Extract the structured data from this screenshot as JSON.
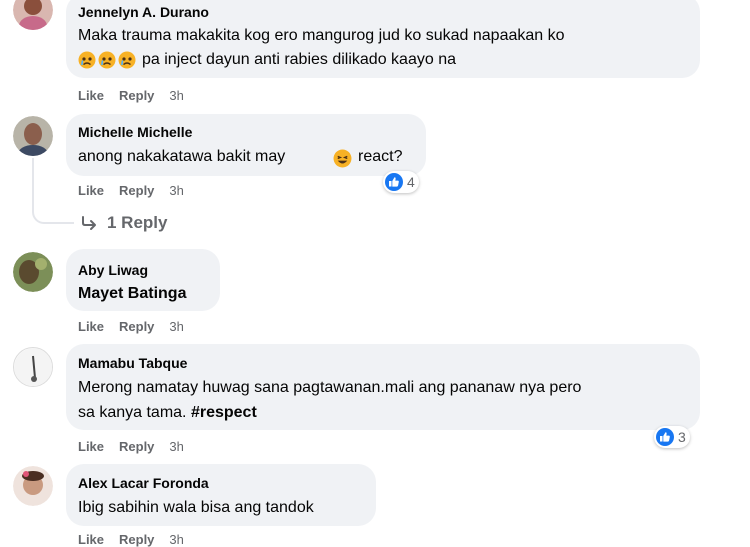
{
  "comments": [
    {
      "author": "Jennelyn A. Durano",
      "line1": "Maka trauma makakita kog ero mangurog jud ko sukad napaakan ko",
      "line2": "pa inject dayun anti rabies dilikado kaayo na",
      "like": "Like",
      "reply": "Reply",
      "time": "3h"
    },
    {
      "author": "Michelle Michelle",
      "line1_a": "anong nakakatawa bakit may",
      "line1_b": "react?",
      "like": "Like",
      "reply": "Reply",
      "time": "3h",
      "reaction_count": "4",
      "replies_label": "1 Reply"
    },
    {
      "author": "Aby Liwag",
      "line1": "Mayet Batinga",
      "like": "Like",
      "reply": "Reply",
      "time": "3h"
    },
    {
      "author": "Mamabu Tabque",
      "line1": "Merong namatay huwag sana pagtawanan.mali ang pananaw nya pero",
      "line2": "sa kanya tama. #respect",
      "like": "Like",
      "reply": "Reply",
      "time": "3h",
      "reaction_count": "3"
    },
    {
      "author": "Alex Lacar Foronda",
      "line1": "Ibig sabihin wala bisa ang tandok",
      "like": "Like",
      "reply": "Reply",
      "time": "3h"
    }
  ],
  "icons": {
    "reply_arrow": "reply-arrow-icon",
    "crying_emoji": "crying-face-emoji",
    "laughing_emoji": "laughing-face-emoji",
    "like_reaction": "like-reaction-icon"
  },
  "colors": {
    "bubble_bg": "#f0f2f5",
    "secondary_text": "#65676b",
    "like_blue": "#1877f2",
    "emoji_yellow": "#f7b125"
  }
}
